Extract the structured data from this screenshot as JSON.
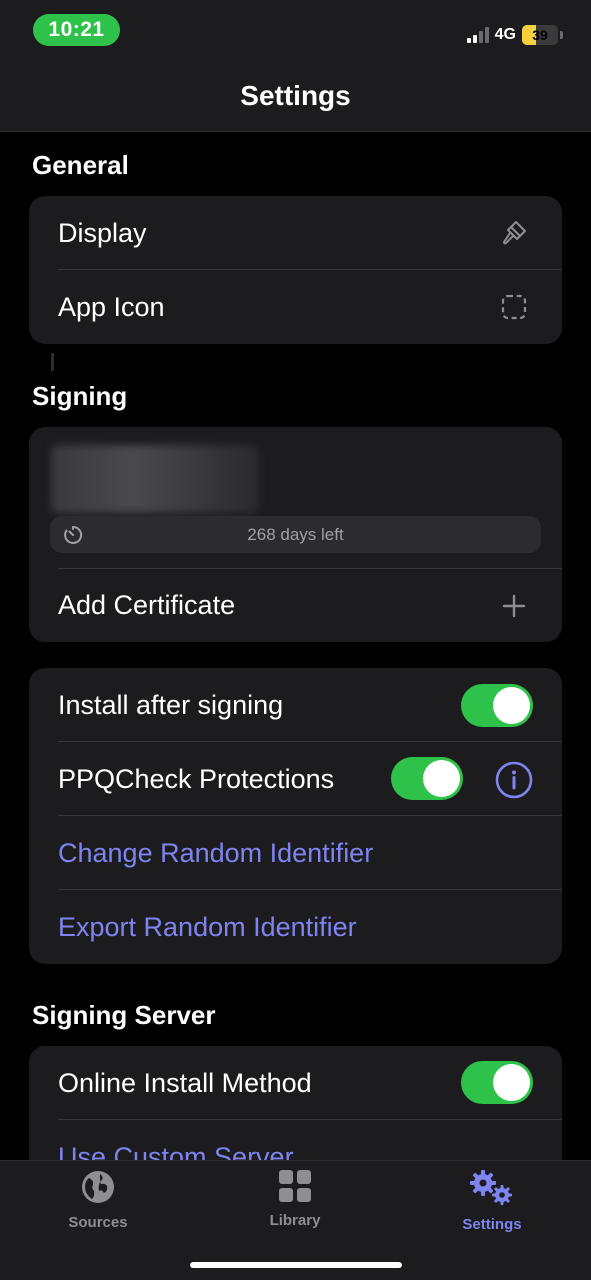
{
  "status_bar": {
    "time": "10:21",
    "network": "4G",
    "battery": "39",
    "battery_level": 0.39
  },
  "nav": {
    "title": "Settings"
  },
  "general": {
    "title": "General",
    "items": [
      {
        "label": "Display",
        "icon": "paintbrush-icon"
      },
      {
        "label": "App Icon",
        "icon": "dashed-square-icon"
      }
    ]
  },
  "signing": {
    "title": "Signing",
    "certificate": {
      "days_left": "268 days left",
      "icon": "timer-icon"
    },
    "add_certificate": {
      "label": "Add Certificate",
      "icon": "plus-icon"
    }
  },
  "options": {
    "install_after_signing": {
      "label": "Install after signing",
      "on": true
    },
    "ppqcheck": {
      "label": "PPQCheck Protections",
      "on": true,
      "icon": "info-icon"
    },
    "change_identifier": {
      "label": "Change Random Identifier"
    },
    "export_identifier": {
      "label": "Export Random Identifier"
    }
  },
  "signing_server": {
    "title": "Signing Server",
    "online_install": {
      "label": "Online Install Method",
      "on": true
    },
    "custom_server": {
      "label": "Use Custom Server"
    }
  },
  "tabbar": {
    "tabs": [
      {
        "label": "Sources",
        "icon": "globe-icon",
        "active": false
      },
      {
        "label": "Library",
        "icon": "grid-icon",
        "active": false
      },
      {
        "label": "Settings",
        "icon": "gears-icon",
        "active": true
      }
    ]
  },
  "colors": {
    "accent": "#7f84f0",
    "toggle_on": "#2fc24a",
    "card": "#1c1c1e",
    "background": "#000000"
  }
}
